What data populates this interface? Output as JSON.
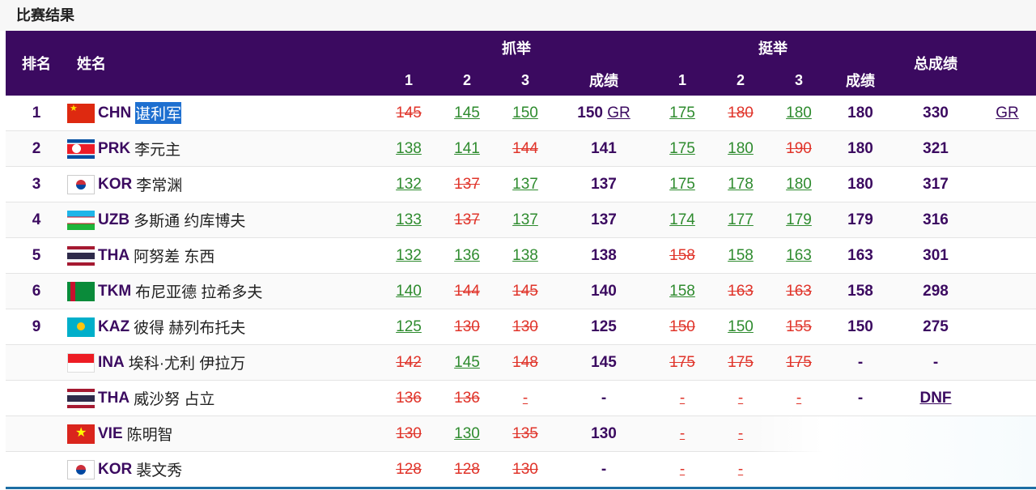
{
  "section_title": "比赛结果",
  "headers": {
    "rank": "排名",
    "name": "姓名",
    "snatch": "抓举",
    "clean_jerk": "挺举",
    "total": "总成绩",
    "attempt1": "1",
    "attempt2": "2",
    "attempt3": "3",
    "result": "成绩"
  },
  "rows": [
    {
      "rank": "1",
      "flag": "chn",
      "code": "CHN",
      "name": "谌利军",
      "selected": true,
      "sn": [
        {
          "v": "145",
          "s": "bad"
        },
        {
          "v": "145",
          "s": "good"
        },
        {
          "v": "150",
          "s": "good"
        }
      ],
      "snr": "150",
      "snr_tag": "GR",
      "cj": [
        {
          "v": "175",
          "s": "good"
        },
        {
          "v": "180",
          "s": "bad"
        },
        {
          "v": "180",
          "s": "good"
        }
      ],
      "cjr": "180",
      "total": "330",
      "tag": "GR"
    },
    {
      "rank": "2",
      "flag": "prk",
      "code": "PRK",
      "name": "李元主",
      "selected": false,
      "sn": [
        {
          "v": "138",
          "s": "good"
        },
        {
          "v": "141",
          "s": "good"
        },
        {
          "v": "144",
          "s": "bad"
        }
      ],
      "snr": "141",
      "snr_tag": "",
      "cj": [
        {
          "v": "175",
          "s": "good"
        },
        {
          "v": "180",
          "s": "good"
        },
        {
          "v": "190",
          "s": "bad"
        }
      ],
      "cjr": "180",
      "total": "321",
      "tag": ""
    },
    {
      "rank": "3",
      "flag": "kor",
      "code": "KOR",
      "name": "李常渊",
      "selected": false,
      "sn": [
        {
          "v": "132",
          "s": "good"
        },
        {
          "v": "137",
          "s": "bad"
        },
        {
          "v": "137",
          "s": "good"
        }
      ],
      "snr": "137",
      "snr_tag": "",
      "cj": [
        {
          "v": "175",
          "s": "good"
        },
        {
          "v": "178",
          "s": "good"
        },
        {
          "v": "180",
          "s": "good"
        }
      ],
      "cjr": "180",
      "total": "317",
      "tag": ""
    },
    {
      "rank": "4",
      "flag": "uzb",
      "code": "UZB",
      "name": "多斯通 约库博夫",
      "selected": false,
      "sn": [
        {
          "v": "133",
          "s": "good"
        },
        {
          "v": "137",
          "s": "bad"
        },
        {
          "v": "137",
          "s": "good"
        }
      ],
      "snr": "137",
      "snr_tag": "",
      "cj": [
        {
          "v": "174",
          "s": "good"
        },
        {
          "v": "177",
          "s": "good"
        },
        {
          "v": "179",
          "s": "good"
        }
      ],
      "cjr": "179",
      "total": "316",
      "tag": ""
    },
    {
      "rank": "5",
      "flag": "tha",
      "code": "THA",
      "name": "阿努差 东西",
      "selected": false,
      "sn": [
        {
          "v": "132",
          "s": "good"
        },
        {
          "v": "136",
          "s": "good"
        },
        {
          "v": "138",
          "s": "good"
        }
      ],
      "snr": "138",
      "snr_tag": "",
      "cj": [
        {
          "v": "158",
          "s": "bad"
        },
        {
          "v": "158",
          "s": "good"
        },
        {
          "v": "163",
          "s": "good"
        }
      ],
      "cjr": "163",
      "total": "301",
      "tag": ""
    },
    {
      "rank": "6",
      "flag": "tkm",
      "code": "TKM",
      "name": "布尼亚德 拉希多夫",
      "selected": false,
      "sn": [
        {
          "v": "140",
          "s": "good"
        },
        {
          "v": "144",
          "s": "bad"
        },
        {
          "v": "145",
          "s": "bad"
        }
      ],
      "snr": "140",
      "snr_tag": "",
      "cj": [
        {
          "v": "158",
          "s": "good"
        },
        {
          "v": "163",
          "s": "bad"
        },
        {
          "v": "163",
          "s": "bad"
        }
      ],
      "cjr": "158",
      "total": "298",
      "tag": ""
    },
    {
      "rank": "9",
      "flag": "kaz",
      "code": "KAZ",
      "name": "彼得 赫列布托夫",
      "selected": false,
      "sn": [
        {
          "v": "125",
          "s": "good"
        },
        {
          "v": "130",
          "s": "bad"
        },
        {
          "v": "130",
          "s": "bad"
        }
      ],
      "snr": "125",
      "snr_tag": "",
      "cj": [
        {
          "v": "150",
          "s": "bad"
        },
        {
          "v": "150",
          "s": "good"
        },
        {
          "v": "155",
          "s": "bad"
        }
      ],
      "cjr": "150",
      "total": "275",
      "tag": ""
    },
    {
      "rank": "",
      "flag": "ina",
      "code": "INA",
      "name": "埃科·尤利 伊拉万",
      "selected": false,
      "sn": [
        {
          "v": "142",
          "s": "bad"
        },
        {
          "v": "145",
          "s": "good"
        },
        {
          "v": "148",
          "s": "bad"
        }
      ],
      "snr": "145",
      "snr_tag": "",
      "cj": [
        {
          "v": "175",
          "s": "bad"
        },
        {
          "v": "175",
          "s": "bad"
        },
        {
          "v": "175",
          "s": "bad"
        }
      ],
      "cjr": "-",
      "total": "-",
      "tag": ""
    },
    {
      "rank": "",
      "flag": "tha",
      "code": "THA",
      "name": "威沙努 占立",
      "selected": false,
      "sn": [
        {
          "v": "136",
          "s": "bad"
        },
        {
          "v": "136",
          "s": "bad"
        },
        {
          "v": "-",
          "s": "none"
        }
      ],
      "snr": "-",
      "snr_tag": "",
      "cj": [
        {
          "v": "-",
          "s": "none"
        },
        {
          "v": "-",
          "s": "none"
        },
        {
          "v": "-",
          "s": "none"
        }
      ],
      "cjr": "-",
      "total": "DNF",
      "tag": ""
    },
    {
      "rank": "",
      "flag": "vie",
      "code": "VIE",
      "name": "陈明智",
      "selected": false,
      "sn": [
        {
          "v": "130",
          "s": "bad"
        },
        {
          "v": "130",
          "s": "good"
        },
        {
          "v": "135",
          "s": "bad"
        }
      ],
      "snr": "130",
      "snr_tag": "",
      "cj": [
        {
          "v": "-",
          "s": "none"
        },
        {
          "v": "-",
          "s": "none"
        },
        {
          "v": "",
          "s": "none"
        }
      ],
      "cjr": "",
      "total": "",
      "tag": ""
    },
    {
      "rank": "",
      "flag": "kor",
      "code": "KOR",
      "name": "裴文秀",
      "selected": false,
      "sn": [
        {
          "v": "128",
          "s": "bad"
        },
        {
          "v": "128",
          "s": "bad"
        },
        {
          "v": "130",
          "s": "bad"
        }
      ],
      "snr": "-",
      "snr_tag": "",
      "cj": [
        {
          "v": "-",
          "s": "none"
        },
        {
          "v": "-",
          "s": "none"
        },
        {
          "v": "",
          "s": "none"
        }
      ],
      "cjr": "",
      "total": "",
      "tag": ""
    }
  ],
  "colors": {
    "header_bg": "#3b0a60",
    "good": "#2e8b2e",
    "bad": "#e0342a",
    "accent": "#3b0a60"
  }
}
